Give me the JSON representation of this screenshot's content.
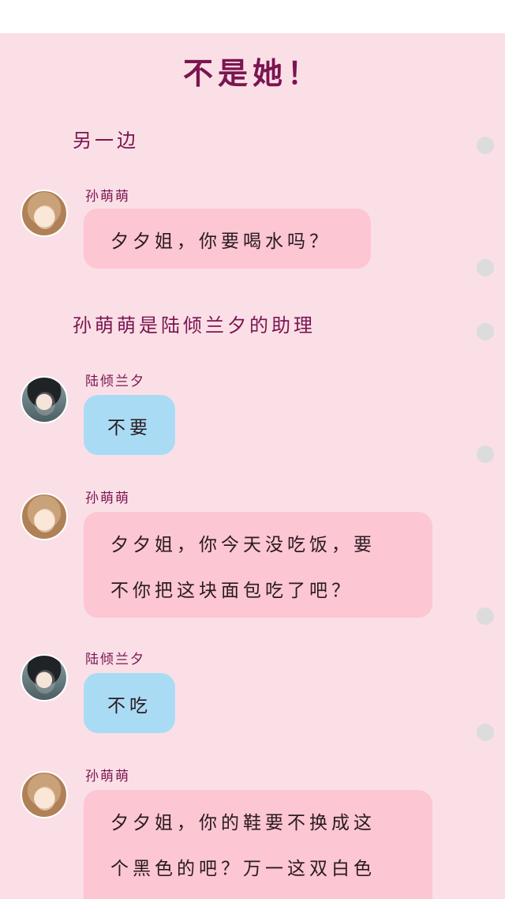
{
  "title": "不是她！",
  "narrations": [
    "另一边",
    "孙萌萌是陆倾兰夕的助理"
  ],
  "messages": [
    {
      "speaker": "孙萌萌",
      "lines": [
        "夕夕姐，你要喝水吗？"
      ]
    },
    {
      "speaker": "陆倾兰夕",
      "lines": [
        "不要"
      ]
    },
    {
      "speaker": "孙萌萌",
      "lines": [
        "夕夕姐，你今天没吃饭，要",
        "不你把这块面包吃了吧？"
      ]
    },
    {
      "speaker": "陆倾兰夕",
      "lines": [
        "不吃"
      ]
    },
    {
      "speaker": "孙萌萌",
      "lines": [
        "夕夕姐，你的鞋要不换成这",
        "个黑色的吧？万一这双白色"
      ]
    }
  ],
  "colors": {
    "background": "#fbdfe6",
    "accent": "#7a1550",
    "bubble_pink": "#fcc6d3",
    "bubble_blue": "#a9dcf4",
    "scroll_dot": "#dcdcdc"
  }
}
